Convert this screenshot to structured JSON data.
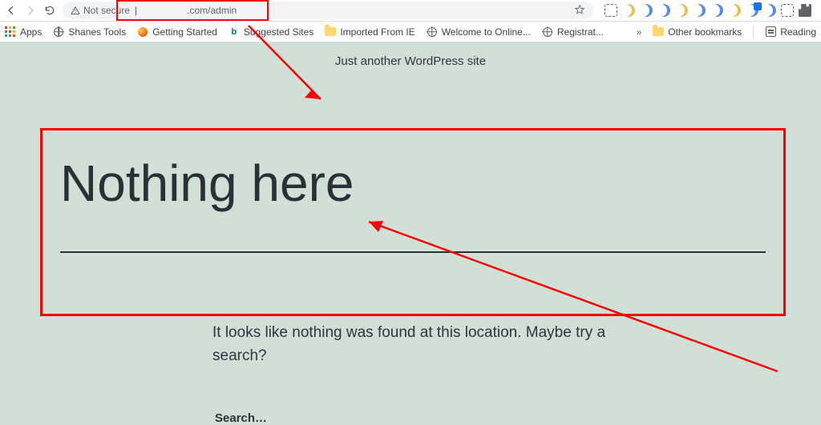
{
  "browser": {
    "not_secure_label": "Not secure",
    "url_host_masked": "",
    "url_visible_suffix": ".com/admin",
    "bookmarks": {
      "apps": "Apps",
      "shanes": "Shanes Tools",
      "getting_started": "Getting Started",
      "suggested": "Suggested Sites",
      "imported": "Imported From IE",
      "welcome": "Welcome to Online...",
      "registrat": "Registrat...",
      "other": "Other bookmarks",
      "reading": "Reading",
      "overflow": "»"
    }
  },
  "page": {
    "tagline": "Just another WordPress site",
    "title": "Nothing here",
    "message": "It looks like nothing was found at this location. Maybe try a search?",
    "search_label": "Search…"
  }
}
